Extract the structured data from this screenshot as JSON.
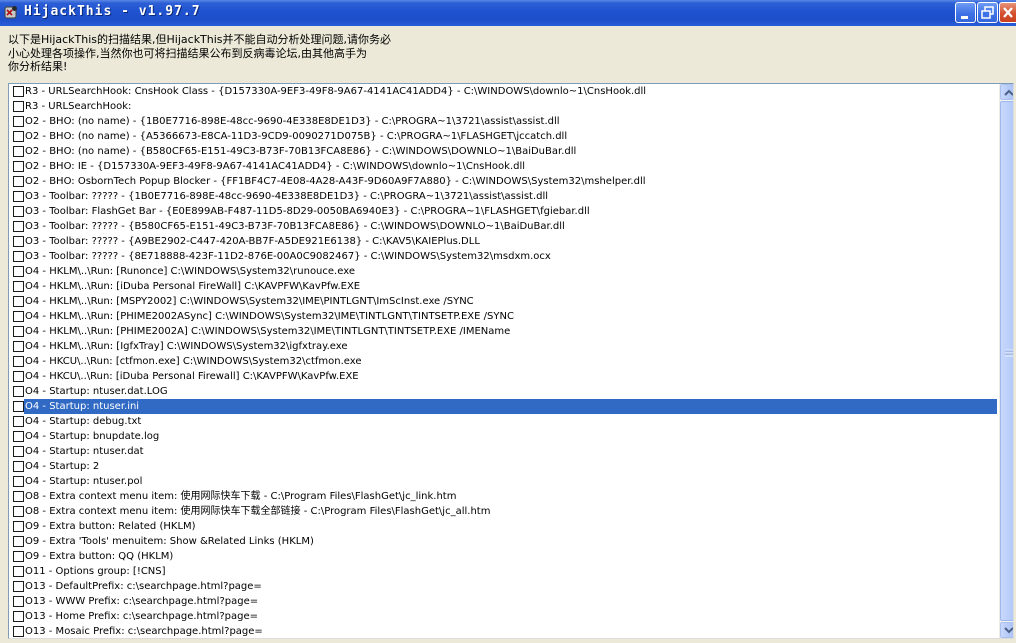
{
  "window": {
    "title": "HijackThis - v1.97.7",
    "icon": "hijackthis-app-icon",
    "controls": {
      "minimize": "minimize-icon",
      "maximize": "restore-icon",
      "close": "close-icon"
    }
  },
  "info": {
    "lines": [
      "以下是HijackThis的扫描结果,但HijackThis并不能自动分析处理问题,请你务必",
      "小心处理各项操作,当然你也可将扫描结果公布到反病毒论坛,由其他高手为",
      "你分析结果!"
    ]
  },
  "colors": {
    "selection": "#316AC5",
    "titlebar": "#1F52CF",
    "background": "#ECE9D8"
  },
  "list": {
    "selected_index": 21,
    "items": [
      "R3 - URLSearchHook: CnsHook Class - {D157330A-9EF3-49F8-9A67-4141AC41ADD4} - C:\\WINDOWS\\downlo~1\\CnsHook.dll",
      "R3 - URLSearchHook:",
      "O2 - BHO: (no name) - {1B0E7716-898E-48cc-9690-4E338E8DE1D3} - C:\\PROGRA~1\\3721\\assist\\assist.dll",
      "O2 - BHO: (no name) - {A5366673-E8CA-11D3-9CD9-0090271D075B} - C:\\PROGRA~1\\FLASHGET\\jccatch.dll",
      "O2 - BHO: (no name) - {B580CF65-E151-49C3-B73F-70B13FCA8E86} - C:\\WINDOWS\\DOWNLO~1\\BaiDuBar.dll",
      "O2 - BHO: IE - {D157330A-9EF3-49F8-9A67-4141AC41ADD4} - C:\\WINDOWS\\downlo~1\\CnsHook.dll",
      "O2 - BHO: OsbornTech Popup Blocker - {FF1BF4C7-4E08-4A28-A43F-9D60A9F7A880} - C:\\WINDOWS\\System32\\mshelper.dll",
      "O3 - Toolbar: ????? - {1B0E7716-898E-48cc-9690-4E338E8DE1D3} - C:\\PROGRA~1\\3721\\assist\\assist.dll",
      "O3 - Toolbar: FlashGet Bar - {E0E899AB-F487-11D5-8D29-0050BA6940E3} - C:\\PROGRA~1\\FLASHGET\\fgiebar.dll",
      "O3 - Toolbar: ????? - {B580CF65-E151-49C3-B73F-70B13FCA8E86} - C:\\WINDOWS\\DOWNLO~1\\BaiDuBar.dll",
      "O3 - Toolbar: ????? - {A9BE2902-C447-420A-BB7F-A5DE921E6138} - C:\\KAV5\\KAIEPlus.DLL",
      "O3 - Toolbar: ????? - {8E718888-423F-11D2-876E-00A0C9082467} - C:\\WINDOWS\\System32\\msdxm.ocx",
      "O4 - HKLM\\..\\Run: [Runonce] C:\\WINDOWS\\System32\\runouce.exe",
      "O4 - HKLM\\..\\Run: [iDuba Personal FireWall] C:\\KAVPFW\\KavPfw.EXE",
      "O4 - HKLM\\..\\Run: [MSPY2002] C:\\WINDOWS\\System32\\IME\\PINTLGNT\\ImScInst.exe /SYNC",
      "O4 - HKLM\\..\\Run: [PHIME2002ASync] C:\\WINDOWS\\System32\\IME\\TINTLGNT\\TINTSETP.EXE /SYNC",
      "O4 - HKLM\\..\\Run: [PHIME2002A] C:\\WINDOWS\\System32\\IME\\TINTLGNT\\TINTSETP.EXE /IMEName",
      "O4 - HKLM\\..\\Run: [IgfxTray] C:\\WINDOWS\\System32\\igfxtray.exe",
      "O4 - HKCU\\..\\Run: [ctfmon.exe] C:\\WINDOWS\\System32\\ctfmon.exe",
      "O4 - HKCU\\..\\Run: [iDuba Personal Firewall] C:\\KAVPFW\\KavPfw.EXE",
      "O4 - Startup: ntuser.dat.LOG",
      "O4 - Startup: ntuser.ini",
      "O4 - Startup: debug.txt",
      "O4 - Startup: bnupdate.log",
      "O4 - Startup: ntuser.dat",
      "O4 - Startup: 2",
      "O4 - Startup: ntuser.pol",
      "O8 - Extra context menu item: 使用网际快车下载 - C:\\Program Files\\FlashGet\\jc_link.htm",
      "O8 - Extra context menu item: 使用网际快车下载全部链接 - C:\\Program Files\\FlashGet\\jc_all.htm",
      "O9 - Extra button: Related (HKLM)",
      "O9 - Extra 'Tools' menuitem: Show &Related Links (HKLM)",
      "O9 - Extra button: QQ (HKLM)",
      "O11 - Options group: [!CNS]",
      "O13 - DefaultPrefix: c:\\searchpage.html?page=",
      "O13 - WWW Prefix: c:\\searchpage.html?page=",
      "O13 - Home Prefix: c:\\searchpage.html?page=",
      "O13 - Mosaic Prefix: c:\\searchpage.html?page="
    ]
  },
  "scrollbar": {
    "up": "scroll-up-arrow-icon",
    "down": "scroll-down-arrow-icon",
    "grip": "scroll-grip-icon"
  }
}
